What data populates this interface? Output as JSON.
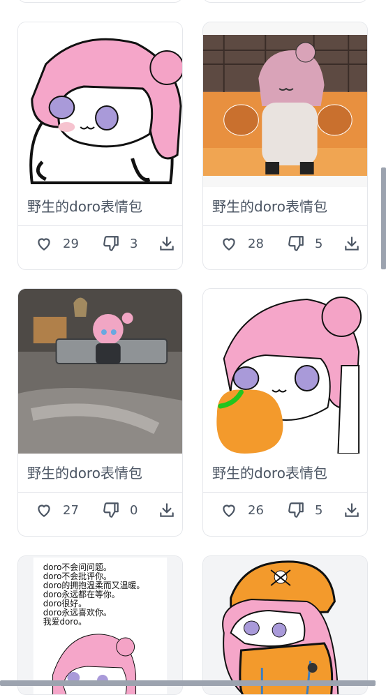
{
  "cards": [
    {
      "title": "野生的doro表情包",
      "likes": "29",
      "dislikes": "3"
    },
    {
      "title": "野生的doro表情包",
      "likes": "28",
      "dislikes": "5"
    },
    {
      "title": "野生的doro表情包",
      "likes": "27",
      "dislikes": "0"
    },
    {
      "title": "野生的doro表情包",
      "likes": "26",
      "dislikes": "5"
    },
    {
      "caption_lines": [
        "doro不会问问题。",
        "doro不会批评你。",
        "doro的拥抱温柔而又温暖。",
        "doro永远都在等你。",
        "doro很好。",
        "doro永远喜欢你。",
        "我爱doro。"
      ]
    },
    {}
  ],
  "icons": {
    "like": "heart-icon",
    "dislike": "thumbs-down-icon",
    "download": "download-icon"
  },
  "colors": {
    "pink": "#f5a6c9",
    "orange": "#f39a2c",
    "border": "#e5e7eb",
    "text": "#4b5563"
  }
}
